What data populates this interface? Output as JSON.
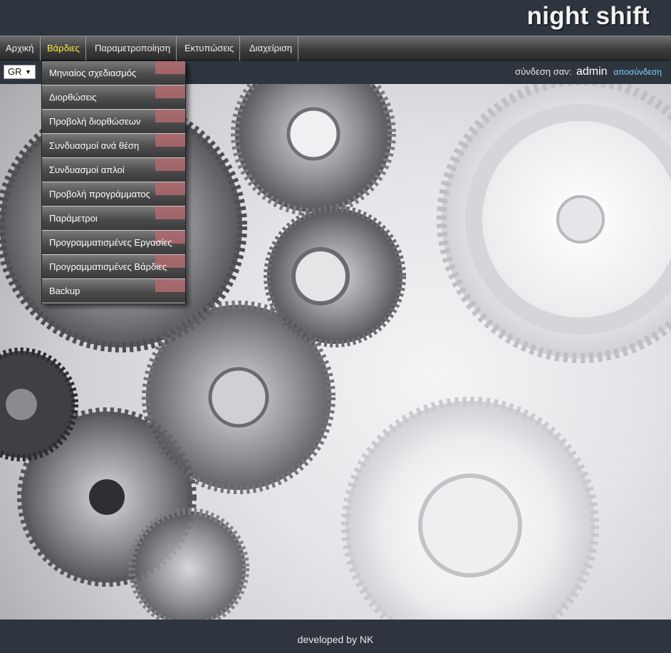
{
  "app": {
    "title": "night shift"
  },
  "nav": {
    "items": [
      {
        "label": "Αρχική",
        "active": false
      },
      {
        "label": "Βάρδιες",
        "active": true
      },
      {
        "label": "Παραμετροποίηση",
        "active": false
      },
      {
        "label": "Εκτυπώσεις",
        "active": false
      },
      {
        "label": "Διαχείριση",
        "active": false
      }
    ]
  },
  "language": {
    "selected": "GR"
  },
  "login": {
    "prefix": "σύνδεση σαν:",
    "user": "admin",
    "logout": "αποσύνδεση"
  },
  "dropdown": {
    "items": [
      {
        "label": "Μηνιαίος σχεδιασμός"
      },
      {
        "label": "Διορθώσεις"
      },
      {
        "label": "Προβολή διορθώσεων"
      },
      {
        "label": "Συνδυασμοί ανά θέση"
      },
      {
        "label": "Συνδυασμοί απλοί"
      },
      {
        "label": "Προβολή προγράμματος"
      },
      {
        "label": "Παράμετροι"
      },
      {
        "label": "Προγραμματισμένες Εργασίες"
      },
      {
        "label": "Προγραμματισμένες Βάρδιες"
      },
      {
        "label": "Backup"
      }
    ]
  },
  "footer": {
    "text": "developed by NK"
  },
  "colors": {
    "background": "#2e353f",
    "active_nav": "#ffef3a",
    "link": "#7fd6ff",
    "accent": "#b06a6e"
  }
}
